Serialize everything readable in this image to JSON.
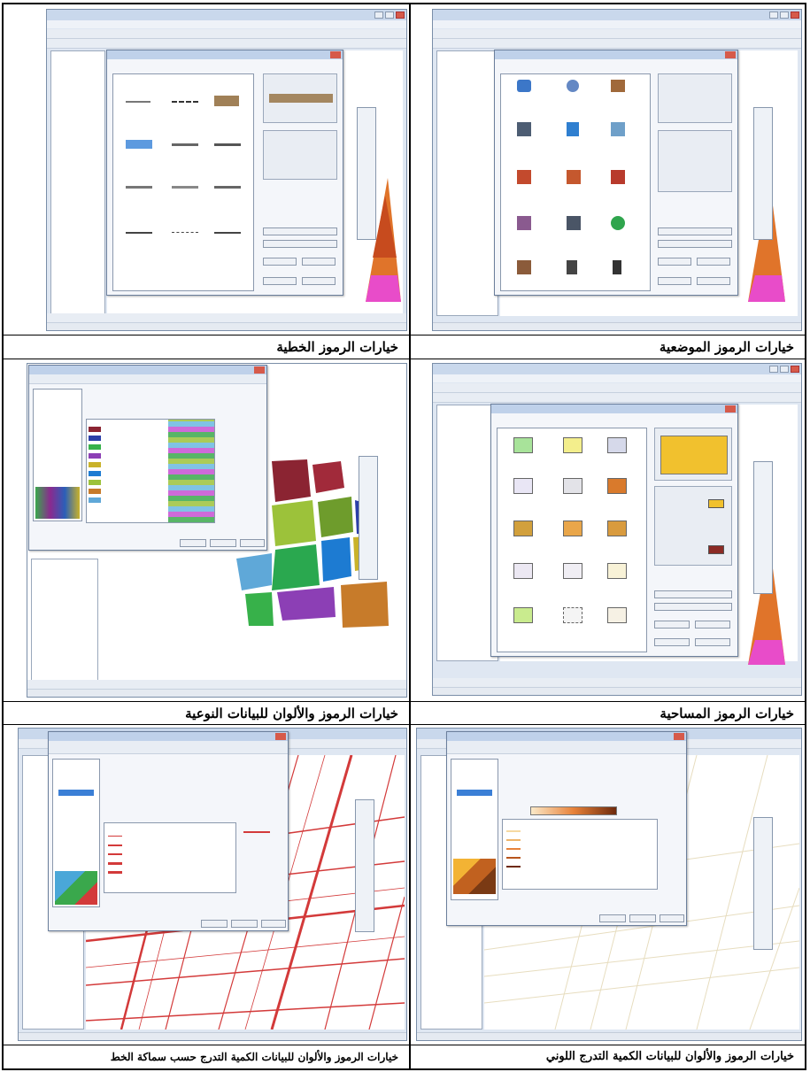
{
  "captions": {
    "top_right": "خيارات الرموز الخطية",
    "top_left": "خيارات الرموز الموضعية",
    "mid_right": "خيارات الرموز والألوان للبيانات النوعية",
    "mid_left": "خيارات الرموز المساحية",
    "bottom_right": "خيارات الرموز والألوان للبيانات الكمية التدرج حسب سماكة الخط",
    "bottom_left": "خيارات الرموز والألوان للبيانات الكمية التدرج اللوني"
  },
  "colors": {
    "window_bg": "#dfe7f2",
    "titlebar": "#c9d8ec",
    "dialog_bg": "#f4f6fa",
    "close_red": "#d65a4a",
    "map_line_red": "#d33a3a",
    "map_line_beige": "#e7ddbf"
  },
  "icons": [
    "window-close-icon",
    "checkbox-icon",
    "tool-icon",
    "symbol-swatch-icon"
  ]
}
